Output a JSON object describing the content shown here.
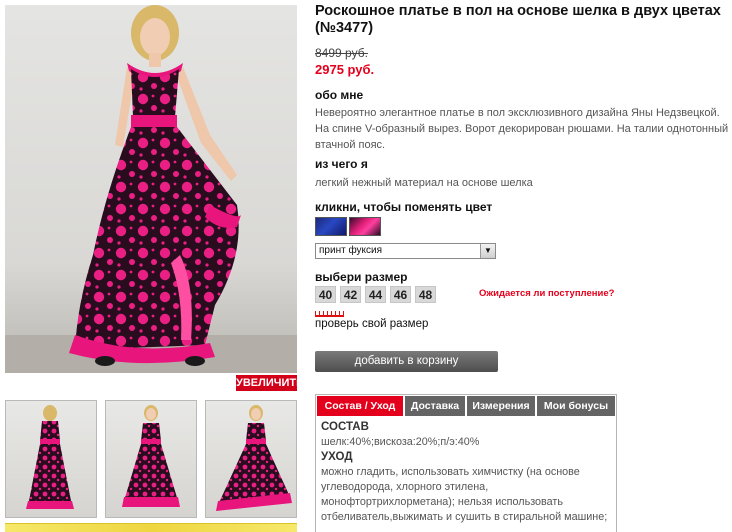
{
  "product": {
    "title": "Роскошное платье в пол на основе шелка в двух цветах (№3477)",
    "old_price": "8499 руб.",
    "new_price": "2975 руб."
  },
  "about": {
    "heading": "обо мне",
    "text": "Невероятно элегантное платье в пол эксклюзивного дизайна Яны Недзвецкой. На спине V-образный вырез. Ворот декорирован рюшами. На талии однотонный втачной пояс."
  },
  "material": {
    "heading": "из чего я",
    "text": "легкий нежный материал на основе шелка"
  },
  "color": {
    "heading": "кликни, чтобы поменять цвет",
    "swatches": [
      "blue",
      "fuchsia"
    ],
    "selected": "принт фуксия"
  },
  "size": {
    "heading": "выбери размер",
    "options": [
      "40",
      "42",
      "44",
      "46",
      "48"
    ],
    "notify_link": "Ожидается ли поступление?",
    "check_link": "проверь свой размер"
  },
  "cart": {
    "button_label": "добавить в корзину"
  },
  "gallery": {
    "zoom_label": "УВЕЛИЧИТЬ"
  },
  "tabs": {
    "items": [
      "Состав / Уход",
      "Доставка",
      "Измерения",
      "Мои бонусы"
    ],
    "active_index": 0,
    "content": {
      "composition_heading": "СОСТАВ",
      "composition_text": "шелк:40%;вискоза:20%;п/э:40%",
      "care_heading": "УХОД",
      "care_text": "можно гладить, использовать химчистку (на основе углеводорода, хлорного этилена, монофтортрихлорметана); нельзя использовать отбеливатель,выжимать и сушить в стиральной машине;"
    }
  },
  "colors": {
    "accent_red": "#e4001c",
    "dark_button": "#5a5a5a",
    "dress_pink": "#e8157d"
  }
}
